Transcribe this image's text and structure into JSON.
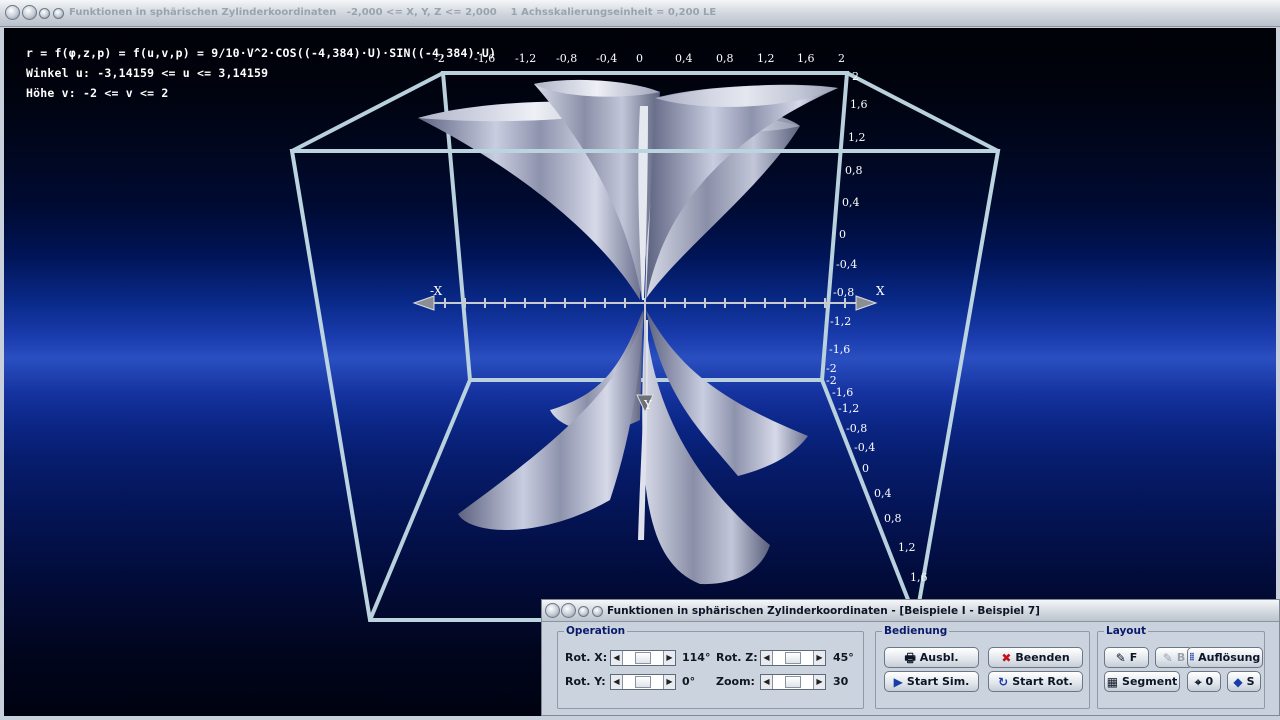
{
  "main_window": {
    "title": "Funktionen in sphärischen Zylinderkoordinaten   -2,000 <= X, Y, Z <= 2,000    1 Achsskalierungseinheit = 0,200 LE"
  },
  "info": {
    "formula": "r = f(φ,z,p) = f(u,v,p) = 9/10·V^2·COS((-4,384)·U)·SIN((-4,384)·U)",
    "angle_range": "Winkel u: -3,14159 <= u <= 3,14159",
    "height_range": "Höhe v: -2 <= v <= 2"
  },
  "axes": {
    "x_label_neg": "-X",
    "x_label_pos": "X",
    "y_label": "Y",
    "top_ticks": [
      "-2",
      "-1,6",
      "-1,2",
      "-0,8",
      "-0,4",
      "0",
      "0,4",
      "0,8",
      "1,2",
      "1,6",
      "2"
    ],
    "right_ticks": [
      "2",
      "1,6",
      "1,2",
      "0,8",
      "0,4",
      "0",
      "-0,4",
      "-0,8",
      "-1,2",
      "-1,6",
      "-2"
    ],
    "depth_ticks": [
      "-2",
      "-1,6",
      "-1,2",
      "-0,8",
      "-0,4",
      "0",
      "0,4",
      "0,8",
      "1,2",
      "1,6"
    ]
  },
  "colors": {
    "frame": "#bcd4e0",
    "surface": "#9fa5bd",
    "axis": "#c8cbd0"
  },
  "panel": {
    "title": "Funktionen in sphärischen Zylinderkoordinaten - [Beispiele I - Beispiel 7]",
    "operation": {
      "legend": "Operation",
      "rot_x_label": "Rot. X:",
      "rot_x_value": "114°",
      "rot_y_label": "Rot. Y:",
      "rot_y_value": "0°",
      "rot_z_label": "Rot. Z:",
      "rot_z_value": "45°",
      "zoom_label": "Zoom:",
      "zoom_value": "30"
    },
    "bedienung": {
      "legend": "Bedienung",
      "ausbl": "Ausbl.",
      "beenden": "Beenden",
      "start_sim": "Start Sim.",
      "start_rot": "Start Rot."
    },
    "layout": {
      "legend": "Layout",
      "f": "F",
      "b": "B",
      "aufloesung": "Auflösung",
      "segment": "Segment",
      "o": "0",
      "s": "S"
    }
  }
}
